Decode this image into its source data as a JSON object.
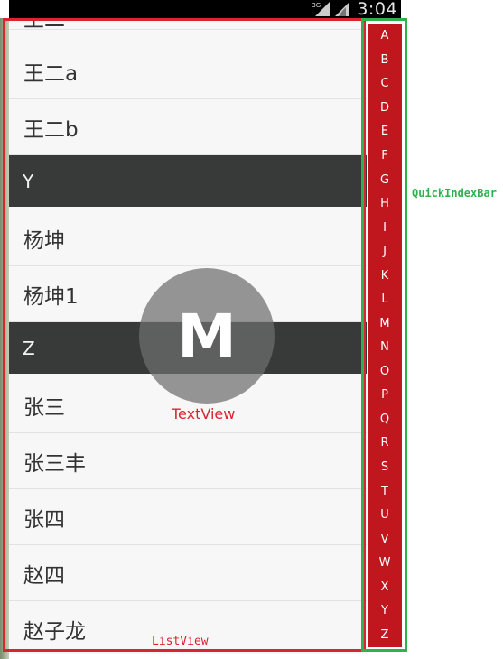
{
  "status_bar": {
    "network_type": "3G",
    "time": "3:04"
  },
  "list": {
    "partial_top_text": "王二",
    "rows": [
      {
        "kind": "item",
        "text": "王二a"
      },
      {
        "kind": "item",
        "text": "王二b"
      },
      {
        "kind": "header",
        "text": "Y"
      },
      {
        "kind": "item",
        "text": "杨坤"
      },
      {
        "kind": "item",
        "text": "杨坤1"
      },
      {
        "kind": "header",
        "text": "Z"
      },
      {
        "kind": "item",
        "text": "张三"
      },
      {
        "kind": "item",
        "text": "张三丰"
      },
      {
        "kind": "item",
        "text": "张四"
      },
      {
        "kind": "item",
        "text": "赵四"
      },
      {
        "kind": "item",
        "text": "赵子龙"
      }
    ]
  },
  "bubble": {
    "letter": "M"
  },
  "quick_index": {
    "letters": [
      "A",
      "B",
      "C",
      "D",
      "E",
      "F",
      "G",
      "H",
      "I",
      "J",
      "K",
      "L",
      "M",
      "N",
      "O",
      "P",
      "Q",
      "R",
      "S",
      "T",
      "U",
      "V",
      "W",
      "X",
      "Y",
      "Z"
    ]
  },
  "annotations": {
    "listview_label": "ListView",
    "textview_label": "TextView",
    "quickindexbar_label": "QuickIndexBar"
  },
  "colors": {
    "index_bar_bg": "#c0161e",
    "header_bg": "#383a39",
    "listview_outline": "#d9252f",
    "quickindex_outline": "#2fb14f"
  }
}
